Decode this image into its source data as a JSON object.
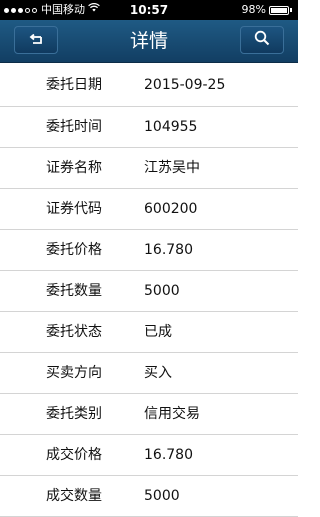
{
  "status_bar": {
    "carrier": "中国移动",
    "time": "10:57",
    "battery": "98%",
    "battery_level": 0.98
  },
  "nav": {
    "title": "详情",
    "back_icon": "back-arrow-icon",
    "search_icon": "search-icon"
  },
  "details": [
    {
      "label": "委托日期",
      "value": "2015-09-25"
    },
    {
      "label": "委托时间",
      "value": "104955"
    },
    {
      "label": "证券名称",
      "value": "江苏吴中"
    },
    {
      "label": "证券代码",
      "value": "600200"
    },
    {
      "label": "委托价格",
      "value": "16.780"
    },
    {
      "label": "委托数量",
      "value": "5000"
    },
    {
      "label": "委托状态",
      "value": "已成"
    },
    {
      "label": "买卖方向",
      "value": "买入"
    },
    {
      "label": "委托类别",
      "value": "信用交易"
    },
    {
      "label": "成交价格",
      "value": "16.780"
    },
    {
      "label": "成交数量",
      "value": "5000"
    }
  ]
}
